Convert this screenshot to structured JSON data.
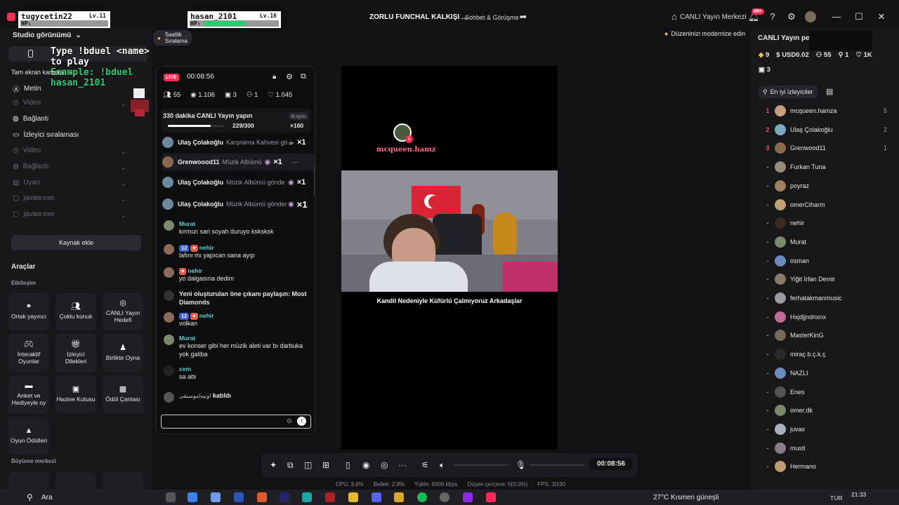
{
  "overlay": {
    "player1": {
      "name": "tugycetin22",
      "level": "Lv.11",
      "hp": "HP:"
    },
    "player2": {
      "name": "hasan_2101",
      "level": "Lv.16",
      "hp": "HP:"
    },
    "duel_line1": "Type !bduel <name> to play",
    "duel_line2": "Example: !bduel hasan_2101"
  },
  "window": {
    "title": "ZORLU FUNCHAL KALKIŞI ...",
    "tab": "Sohbet & Görüşme",
    "live_center": "CANLI Yayın Merkezi",
    "notif": "99+"
  },
  "left": {
    "studio_view": "Studio görünümü",
    "hourly": "Saatlik Sıralama",
    "fullscreen_cam": "Tam ekran kamera",
    "sources": [
      "Metin",
      "Video",
      "Bağlantı",
      "İzleyici sıralaması",
      "Video",
      "Bağlantı",
      "Uyarı",
      "javaw.exe",
      "javaw.exe"
    ],
    "add_source": "Kaynak ekle",
    "tools": "Araçlar",
    "interaction": "Etkileşim",
    "growth": "Büyüme merkezi",
    "tiles": [
      {
        "icon": "link-icon",
        "label": "Ortak yayıncı"
      },
      {
        "icon": "guests-icon",
        "label": "Çoklu konuk"
      },
      {
        "icon": "target-icon",
        "label": "CANLI Yayın Hedefi"
      },
      {
        "icon": "gamepad-icon",
        "label": "İnteraktif Oyunlar"
      },
      {
        "icon": "gift-icon",
        "label": "İzleyici Dilekleri"
      },
      {
        "icon": "play-together-icon",
        "label": "Birlikte Oyna"
      },
      {
        "icon": "poll-icon",
        "label": "Anket ve Hediyeyle oy"
      },
      {
        "icon": "treasure-icon",
        "label": "Hazine Kutusu"
      },
      {
        "icon": "reward-bag-icon",
        "label": "Ödül Çantası"
      },
      {
        "icon": "game-reward-icon",
        "label": "Oyun Ödülleri"
      }
    ]
  },
  "chat": {
    "live": "LIVE",
    "timer": "00:08:56",
    "stats": {
      "likes": "55",
      "views": "1.106",
      "gifts": "3",
      "followers": "1",
      "hearts": "1.045"
    },
    "goal": {
      "title": "330 dakika CANLI Yayın yapın",
      "when": "Bugün",
      "progress": "229/300",
      "progress_frac": 0.763,
      "reward": "×160"
    },
    "gifts": [
      {
        "user": "Ulaş Çolakoğlu",
        "gift": "Karşılama Kahvesi gö",
        "count": "×1"
      },
      {
        "user": "Grenwoood11",
        "gift": "Müzik Albümü",
        "count": "×1"
      },
      {
        "user": "Ulaş Çolakoğlu",
        "gift": "Müzik Albümü gönde",
        "count": "×1"
      },
      {
        "user": "Ulaş Çolakoğlu",
        "gift": "Müzik Albümü gönder",
        "count": "×1"
      }
    ],
    "messages": [
      {
        "user": "Murat",
        "text": "kırmızı sari soyah duruyo ksksksk",
        "level": ""
      },
      {
        "user": "nehir",
        "text": "lafını mı yapıcan sana ayıp",
        "level": "12"
      },
      {
        "user": "nehir",
        "text": "yo dalgasına dedim",
        "level": ""
      },
      {
        "user": "",
        "text": "Yeni oluşturulan öne çıkanı paylaşın: Most Diamonds",
        "level": ""
      },
      {
        "user": "nehir",
        "text": "volkan",
        "level": "12"
      },
      {
        "user": "Murat",
        "text": "ev konser gibi her müzik aleti var bı darbuka yok galiba",
        "level": ""
      },
      {
        "user": "cem",
        "text": "sa abi",
        "level": ""
      },
      {
        "user": "اونيه|موسيقى",
        "text": "katıldı",
        "level": ""
      }
    ]
  },
  "stage": {
    "viewer_tag": "mcqueen.hamz",
    "caption": "Kandil Nedeniyle Küfürlü Çalmıyoruz Arkadaşlar",
    "modernize": "Düzeninizi modernize edin"
  },
  "controls": {
    "time": "00:08:56"
  },
  "statusbar": {
    "cpu": "CPU: 3.6%",
    "memory": "Bellek: 2.9%",
    "upload": "Yükle: 6006 kbps",
    "dropped": "Düşen çerçeve: 0(0.0%)",
    "fps": "FPS: 30/30"
  },
  "right": {
    "title": "CANLI Yayın pe",
    "diamonds": "9",
    "usd": "USD0.02",
    "viewers": "55",
    "follows": "1",
    "likes": "1K",
    "gifts": "3",
    "top_viewers": "En iyi izleyiciler",
    "ranking": [
      {
        "rank": "1",
        "name": "mcqueen.hamza",
        "score": "5"
      },
      {
        "rank": "2",
        "name": "Ulaş Çolakoğlu",
        "score": "2"
      },
      {
        "rank": "3",
        "name": "Grenwood11",
        "score": "1"
      },
      {
        "rank": "-",
        "name": "Furkan Tuna",
        "score": ""
      },
      {
        "rank": "-",
        "name": "poyraz",
        "score": ""
      },
      {
        "rank": "-",
        "name": "omerCiharm",
        "score": ""
      },
      {
        "rank": "-",
        "name": "nehir",
        "score": ""
      },
      {
        "rank": "-",
        "name": "Murat",
        "score": ""
      },
      {
        "rank": "-",
        "name": "osman",
        "score": ""
      },
      {
        "rank": "-",
        "name": "Yiğit İrfan Demir",
        "score": ""
      },
      {
        "rank": "-",
        "name": "ferhatakmanmusic",
        "score": ""
      },
      {
        "rank": "-",
        "name": "Hxjdjjndnxnx",
        "score": ""
      },
      {
        "rank": "-",
        "name": "MasterKinG",
        "score": ""
      },
      {
        "rank": "-",
        "name": "miraç b.ç.k.ç",
        "score": ""
      },
      {
        "rank": "-",
        "name": "NAZLI",
        "score": ""
      },
      {
        "rank": "-",
        "name": "Enes",
        "score": ""
      },
      {
        "rank": "-",
        "name": "omer.dk",
        "score": ""
      },
      {
        "rank": "-",
        "name": "juvax",
        "score": ""
      },
      {
        "rank": "-",
        "name": "musti",
        "score": ""
      },
      {
        "rank": "-",
        "name": "Hermano",
        "score": ""
      }
    ]
  },
  "taskbar": {
    "search": "Ara",
    "weather": "27°C  Kısmen güneşli",
    "lang": "TUR",
    "clock": "21:33"
  },
  "colors": {
    "accent": "#fe2c55",
    "cyan": "#5ecfcf",
    "hpgreen": "#2ecc71"
  }
}
